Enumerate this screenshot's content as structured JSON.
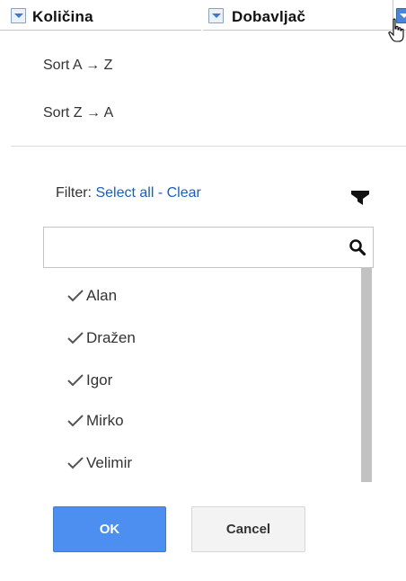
{
  "header": {
    "columns": [
      {
        "label": "Količina"
      },
      {
        "label": "Dobavljač"
      }
    ]
  },
  "sort": {
    "asc_label": "Sort A → Z",
    "desc_label": "Sort Z → A"
  },
  "filter": {
    "label": "Filter:",
    "select_all": "Select all",
    "separator": " - ",
    "clear": "Clear"
  },
  "search": {
    "value": "",
    "placeholder": ""
  },
  "values": [
    {
      "label": "Alan",
      "checked": true
    },
    {
      "label": "Dražen",
      "checked": true
    },
    {
      "label": "Igor",
      "checked": true
    },
    {
      "label": "Mirko",
      "checked": true
    },
    {
      "label": "Velimir",
      "checked": true
    }
  ],
  "buttons": {
    "ok": "OK",
    "cancel": "Cancel"
  },
  "colors": {
    "primary": "#4d8ff0",
    "link": "#1a5fbf",
    "dropdown_accent": "#3f78c8"
  },
  "icons": {
    "header_dropdown": "dropdown-arrow-icon",
    "cursor": "hand-pointer-icon",
    "filter": "funnel-icon",
    "search": "magnifier-icon",
    "item_check": "checkmark-icon"
  }
}
